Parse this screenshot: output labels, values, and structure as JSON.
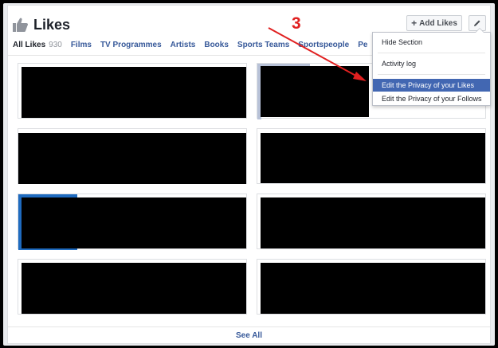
{
  "header": {
    "title": "Likes",
    "add_button_label": "Add Likes"
  },
  "tabs": [
    {
      "label": "All Likes",
      "count": "930",
      "active": true
    },
    {
      "label": "Films"
    },
    {
      "label": "TV Programmes"
    },
    {
      "label": "Artists"
    },
    {
      "label": "Books"
    },
    {
      "label": "Sports Teams"
    },
    {
      "label": "Sportspeople"
    },
    {
      "label": "People"
    }
  ],
  "menu": {
    "items": [
      {
        "label": "Hide Section"
      },
      {
        "label": "Activity log"
      },
      {
        "label": "Edit the Privacy of your Likes",
        "highlighted": true
      },
      {
        "label": "Edit the Privacy of your Follows"
      }
    ]
  },
  "annotation": {
    "number": "3",
    "color": "#e02020"
  },
  "footer": {
    "see_all": "See All"
  },
  "colors": {
    "link": "#365899",
    "highlight": "#4267b2",
    "text": "#1d2129"
  },
  "icons": {
    "title": "thumbs-up-icon",
    "add": "plus-icon",
    "edit": "pencil-icon"
  }
}
